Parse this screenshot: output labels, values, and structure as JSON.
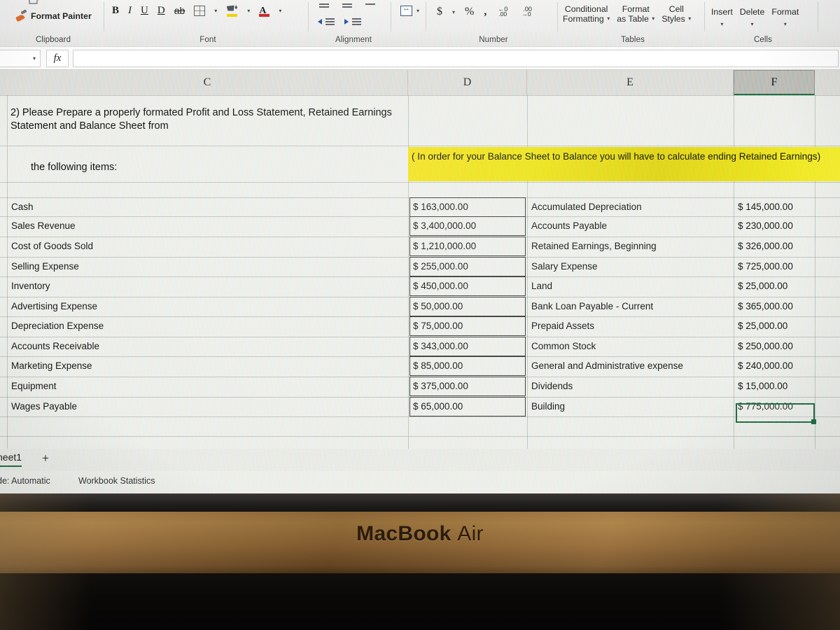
{
  "ribbon": {
    "groups": [
      {
        "label": "Clipboard"
      },
      {
        "label": "Font"
      },
      {
        "label": "Alignment"
      },
      {
        "label": "Number"
      },
      {
        "label": "Tables"
      },
      {
        "label": "Cells"
      }
    ],
    "clipboard": {
      "format_painter": "Format Painter",
      "format_painter_icon": "paintbrush-icon",
      "group_label": "Clipboard"
    },
    "font": {
      "bold": "B",
      "italic": "I",
      "underline": "U",
      "double_underline": "D",
      "strikethrough": "ab",
      "borders_icon": "borders-icon",
      "fill_color_icon": "fill-color-icon",
      "font_color": "A",
      "group_label": "Font"
    },
    "alignment": {
      "group_label": "Alignment",
      "align_top_icon": "align-top-icon",
      "align_middle_icon": "align-middle-icon",
      "align_bottom_icon": "align-bottom-icon",
      "decrease_indent_icon": "decrease-indent-icon",
      "increase_indent_icon": "increase-indent-icon",
      "wrap_text_icon": "merge-cells-icon"
    },
    "number": {
      "group_label": "Number",
      "currency": "$",
      "percent": "%",
      "comma": ",",
      "increase_decimal": ".00",
      "decrease_decimal": ".00"
    },
    "tables": {
      "group_label": "Tables",
      "conditional_formatting_l1": "Conditional",
      "conditional_formatting_l2": "Formatting",
      "format_as_table_l1": "Format",
      "format_as_table_l2": "as Table",
      "cell_styles_l1": "Cell",
      "cell_styles_l2": "Styles"
    },
    "cells": {
      "group_label": "Cells",
      "insert": "Insert",
      "delete": "Delete",
      "format": "Format"
    },
    "editing": {
      "icon": "editing-diamond-icon"
    }
  },
  "formula_bar": {
    "name_box_value": "",
    "fx_label": "fx",
    "formula_value": ""
  },
  "columns": [
    {
      "label": "C",
      "selected": false
    },
    {
      "label": "D",
      "selected": false
    },
    {
      "label": "E",
      "selected": false
    },
    {
      "label": "F",
      "selected": true
    }
  ],
  "sheet": {
    "question": "2) Please Prepare a properly formated Profit and Loss Statement, Retained Earnings Statement and Balance Sheet from",
    "question_sub": "the following items:",
    "note_highlight": "( In order for your Balance Sheet to Balance you will have to calculate ending Retained Earnings)",
    "note_color": "#e9e11a",
    "rows": [
      {
        "c": "Cash",
        "d": "$ 163,000.00",
        "e": "Accumulated Depreciation",
        "f": "$ 145,000.00"
      },
      {
        "c": "Sales Revenue",
        "d": "$ 3,400,000.00",
        "e": "Accounts Payable",
        "f": "$ 230,000.00"
      },
      {
        "c": "Cost of Goods Sold",
        "d": "$ 1,210,000.00",
        "e": "Retained Earnings, Beginning",
        "f": "$ 326,000.00"
      },
      {
        "c": "Selling Expense",
        "d": "$ 255,000.00",
        "e": "Salary Expense",
        "f": "$ 725,000.00"
      },
      {
        "c": "Inventory",
        "d": "$ 450,000.00",
        "e": "Land",
        "f": "$ 25,000.00"
      },
      {
        "c": "Advertising Expense",
        "d": "$ 50,000.00",
        "e": "Bank Loan Payable - Current",
        "f": "$ 365,000.00"
      },
      {
        "c": "Depreciation Expense",
        "d": "$ 75,000.00",
        "e": "Prepaid Assets",
        "f": "$ 25,000.00"
      },
      {
        "c": "Accounts Receivable",
        "d": "$ 343,000.00",
        "e": "Common Stock",
        "f": "$ 250,000.00"
      },
      {
        "c": "Marketing Expense",
        "d": "$ 85,000.00",
        "e": "General and Administrative expense",
        "f": "$ 240,000.00"
      },
      {
        "c": "Equipment",
        "d": "$ 375,000.00",
        "e": "Dividends",
        "f": "$ 15,000.00"
      },
      {
        "c": "Wages Payable",
        "d": "$ 65,000.00",
        "e": "Building",
        "f": "$ 775,000.00"
      }
    ],
    "selected_cell_value": "",
    "selection_color": "#1d6b3f"
  },
  "sheet_tabs": {
    "active_tab": "heet1",
    "add_tab": "+"
  },
  "status_bar": {
    "calc_mode": "de: Automatic",
    "workbook_statistics": "Workbook Statistics"
  },
  "hardware": {
    "brand_prefix": "MacBook",
    "brand_suffix": "Air"
  }
}
